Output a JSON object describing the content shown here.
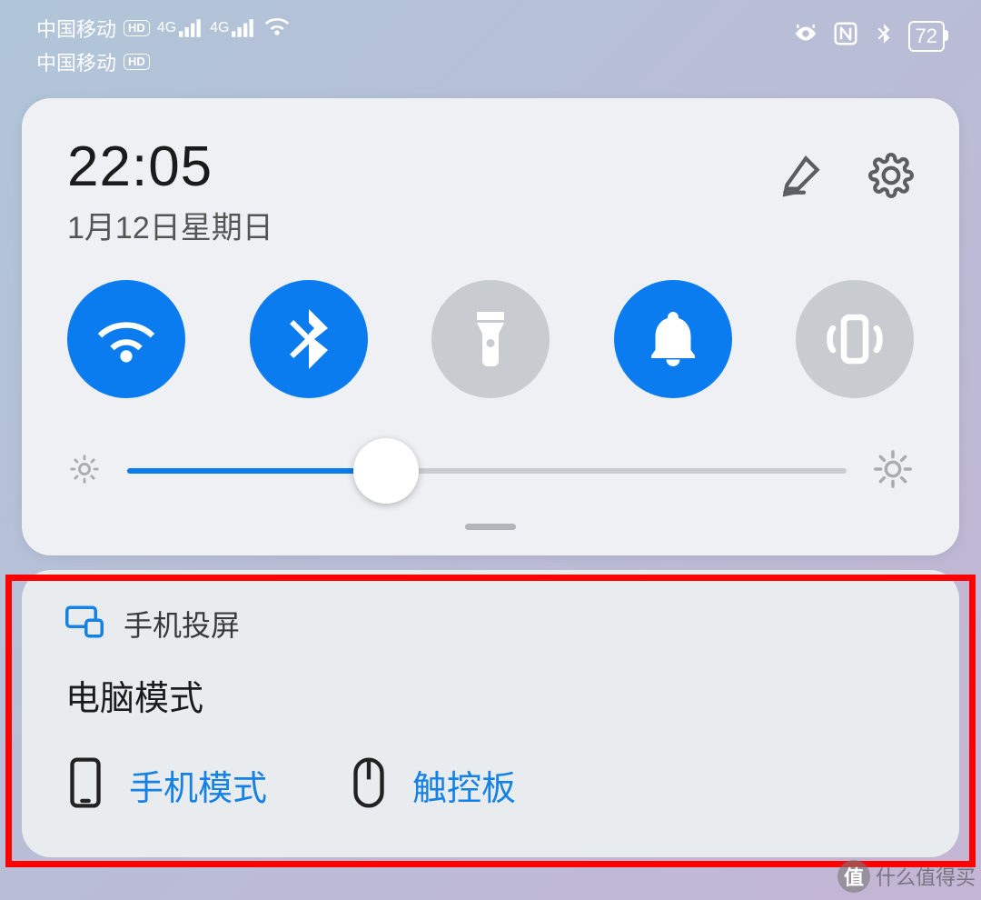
{
  "status": {
    "carrier1": "中国移动",
    "carrier2": "中国移动",
    "hd": "HD",
    "net": "4G",
    "battery": "72"
  },
  "panel": {
    "time": "22:05",
    "date": "1月12日星期日",
    "brightness": {
      "value": 36,
      "max": 100
    }
  },
  "toggles": {
    "wifi": {
      "on": true
    },
    "bluetooth": {
      "on": true
    },
    "flashlight": {
      "on": false
    },
    "sound": {
      "on": true
    },
    "vibrate": {
      "on": false
    }
  },
  "notif": {
    "title": "手机投屏",
    "subtitle": "电脑模式",
    "action_phone": "手机模式",
    "action_touchpad": "触控板"
  },
  "watermark": {
    "glyph": "值",
    "text": "什么值得买"
  }
}
